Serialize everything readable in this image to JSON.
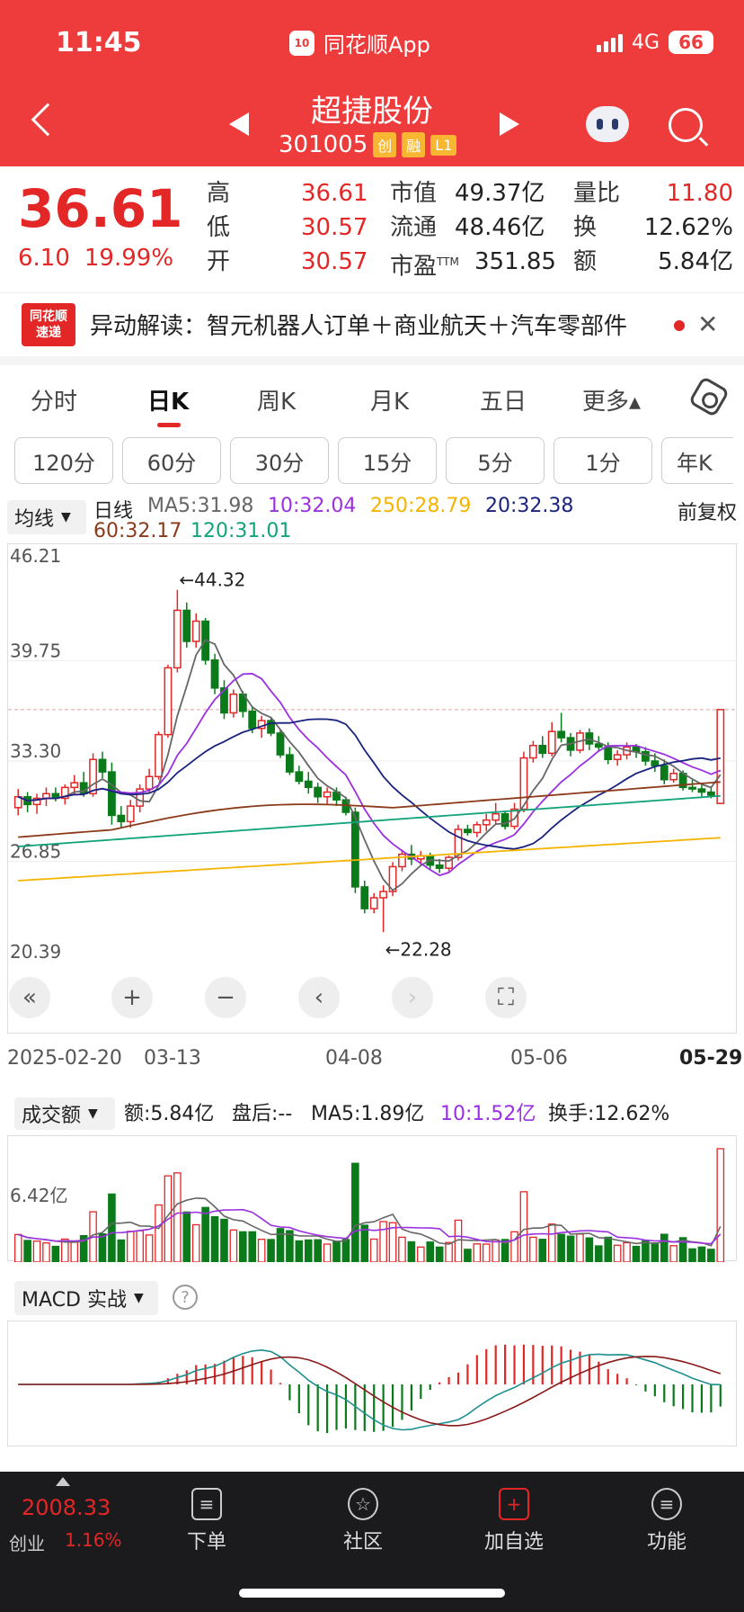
{
  "status": {
    "time": "11:45",
    "app": "同花顺App",
    "network": "4G",
    "battery": "66"
  },
  "stock": {
    "name": "超捷股份",
    "code": "301005",
    "tags": [
      "创",
      "融",
      "L1"
    ]
  },
  "quote": {
    "price": "36.61",
    "change": "6.10",
    "change_pct": "19.99%",
    "high_label": "高",
    "high": "36.61",
    "low_label": "低",
    "low": "30.57",
    "open_label": "开",
    "open": "30.57",
    "mktcap_label": "市值",
    "mktcap": "49.37亿",
    "float_label": "流通",
    "float": "48.46亿",
    "pe_label": "市盈",
    "pe_sup": "TTM",
    "pe": "351.85",
    "volratio_label": "量比",
    "volratio": "11.80",
    "turnover_label": "换",
    "turnover": "12.62%",
    "amount_label": "额",
    "amount": "5.84亿"
  },
  "news": {
    "logo_line1": "同花顺",
    "logo_line2": "速递",
    "text": "异动解读：智元机器人订单＋商业航天＋汽车零部件"
  },
  "tabs": [
    "分时",
    "日K",
    "周K",
    "月K",
    "五日",
    "更多▴"
  ],
  "periods": [
    "120分",
    "60分",
    "30分",
    "15分",
    "5分",
    "1分",
    "年K"
  ],
  "ma": {
    "selector": "均线",
    "type": "日线",
    "ma5": "MA5:31.98",
    "ma10": "10:32.04",
    "ma250": "250:28.79",
    "ma20": "20:32.38",
    "ma60": "60:32.17",
    "ma120": "120:31.01",
    "adjust": "前复权"
  },
  "colors": {
    "up": "#e32626",
    "down": "#0a7a1a",
    "ma5": "#666666",
    "ma10": "#9b30e0",
    "ma20": "#1a237e",
    "ma60": "#8b3a1a",
    "ma120": "#13a37a",
    "ma250": "#f4b400"
  },
  "chart_data": {
    "type": "candlestick",
    "y_labels": [
      "46.21",
      "39.75",
      "33.30",
      "26.85",
      "20.39"
    ],
    "ylim": [
      20.39,
      46.21
    ],
    "x_labels": [
      "2025-02-20",
      "03-13",
      "04-08",
      "05-06",
      "05-29"
    ],
    "annotations": {
      "high": "←44.32",
      "low": "←22.28"
    },
    "candles": [
      [
        30.3,
        31.5,
        29.8,
        31.0
      ],
      [
        31.0,
        31.3,
        30.0,
        30.5
      ],
      [
        30.5,
        31.2,
        29.9,
        30.9
      ],
      [
        30.9,
        31.6,
        30.4,
        31.2
      ],
      [
        31.2,
        31.6,
        30.7,
        30.9
      ],
      [
        30.9,
        31.8,
        30.5,
        31.6
      ],
      [
        31.6,
        32.4,
        31.1,
        31.9
      ],
      [
        31.9,
        32.6,
        31.0,
        31.2
      ],
      [
        31.2,
        33.8,
        31.0,
        33.4
      ],
      [
        33.4,
        33.9,
        32.2,
        32.6
      ],
      [
        32.6,
        33.2,
        29.2,
        29.8
      ],
      [
        29.8,
        30.4,
        29.0,
        29.4
      ],
      [
        29.4,
        30.8,
        29.0,
        30.4
      ],
      [
        30.4,
        31.8,
        30.0,
        31.5
      ],
      [
        31.5,
        32.8,
        31.2,
        32.3
      ],
      [
        32.3,
        35.2,
        32.1,
        35.0
      ],
      [
        35.0,
        39.5,
        34.8,
        39.3
      ],
      [
        39.3,
        44.32,
        39.0,
        43.0
      ],
      [
        43.0,
        43.5,
        40.6,
        41.0
      ],
      [
        41.0,
        42.8,
        40.6,
        42.3
      ],
      [
        42.3,
        42.5,
        39.5,
        39.8
      ],
      [
        39.8,
        40.2,
        37.6,
        38.0
      ],
      [
        38.0,
        38.5,
        36.0,
        36.4
      ],
      [
        36.4,
        37.9,
        36.1,
        37.6
      ],
      [
        37.6,
        37.8,
        36.1,
        36.5
      ],
      [
        36.5,
        36.8,
        35.1,
        35.4
      ],
      [
        35.4,
        36.2,
        34.8,
        35.9
      ],
      [
        35.9,
        36.1,
        34.9,
        35.1
      ],
      [
        35.1,
        35.3,
        33.5,
        33.7
      ],
      [
        33.7,
        34.2,
        32.4,
        32.6
      ],
      [
        32.6,
        33.0,
        31.8,
        32.0
      ],
      [
        32.0,
        32.6,
        31.2,
        31.6
      ],
      [
        31.6,
        31.9,
        30.6,
        31.0
      ],
      [
        31.0,
        31.6,
        30.5,
        31.3
      ],
      [
        31.3,
        31.6,
        30.4,
        30.8
      ],
      [
        30.8,
        31.0,
        29.8,
        30.0
      ],
      [
        30.0,
        30.3,
        24.8,
        25.2
      ],
      [
        25.2,
        25.6,
        23.5,
        23.8
      ],
      [
        23.8,
        24.8,
        23.5,
        24.5
      ],
      [
        24.5,
        25.3,
        22.28,
        24.9
      ],
      [
        24.9,
        26.8,
        24.6,
        26.5
      ],
      [
        26.5,
        27.6,
        26.2,
        27.3
      ],
      [
        27.3,
        27.9,
        26.6,
        27.0
      ],
      [
        27.0,
        27.5,
        26.6,
        27.2
      ],
      [
        27.2,
        27.4,
        26.3,
        26.6
      ],
      [
        26.6,
        27.0,
        26.1,
        26.4
      ],
      [
        26.4,
        27.2,
        26.2,
        27.1
      ],
      [
        27.1,
        29.2,
        26.9,
        28.9
      ],
      [
        28.9,
        29.2,
        28.5,
        28.7
      ],
      [
        28.7,
        29.4,
        28.4,
        29.2
      ],
      [
        29.2,
        29.9,
        28.8,
        29.5
      ],
      [
        29.5,
        30.6,
        29.2,
        29.9
      ],
      [
        29.9,
        30.1,
        28.9,
        29.1
      ],
      [
        29.1,
        30.6,
        28.9,
        30.2
      ],
      [
        30.2,
        33.9,
        30.0,
        33.5
      ],
      [
        33.5,
        34.6,
        33.2,
        34.3
      ],
      [
        34.3,
        34.9,
        33.5,
        33.8
      ],
      [
        33.8,
        35.8,
        33.6,
        35.2
      ],
      [
        35.2,
        36.4,
        34.5,
        34.8
      ],
      [
        34.8,
        35.1,
        33.6,
        34.0
      ],
      [
        34.0,
        35.3,
        33.8,
        35.1
      ],
      [
        35.1,
        35.4,
        34.0,
        34.4
      ],
      [
        34.4,
        34.9,
        33.9,
        34.2
      ],
      [
        34.2,
        34.5,
        33.1,
        33.4
      ],
      [
        33.4,
        34.0,
        33.0,
        33.7
      ],
      [
        33.7,
        34.5,
        33.4,
        34.2
      ],
      [
        34.2,
        34.4,
        33.5,
        33.9
      ],
      [
        33.9,
        34.2,
        33.0,
        33.3
      ],
      [
        33.3,
        33.8,
        32.6,
        33.0
      ],
      [
        33.0,
        33.4,
        31.8,
        32.1
      ],
      [
        32.1,
        32.8,
        31.9,
        32.5
      ],
      [
        32.5,
        32.7,
        31.4,
        31.6
      ],
      [
        31.6,
        32.1,
        31.3,
        31.5
      ],
      [
        31.5,
        31.9,
        31.0,
        31.3
      ],
      [
        31.3,
        31.6,
        30.9,
        31.1
      ],
      [
        30.57,
        36.61,
        30.57,
        36.61
      ]
    ]
  },
  "volume": {
    "selector": "成交额",
    "amount": "额:5.84亿",
    "after": "盘后:--",
    "ma5": "MA5:1.89亿",
    "ma10": "10:1.52亿",
    "turnover": "换手:12.62%",
    "y_label": "6.42亿"
  },
  "macd": {
    "selector": "MACD 实战",
    "help": "?"
  },
  "tabbar": {
    "index_value": "2008.33",
    "index_name": "创业",
    "index_pct": "1.16%",
    "items": [
      "下单",
      "社区",
      "加自选",
      "功能"
    ]
  },
  "controls": [
    "«",
    "+",
    "−",
    "‹",
    "›",
    "⛶"
  ]
}
